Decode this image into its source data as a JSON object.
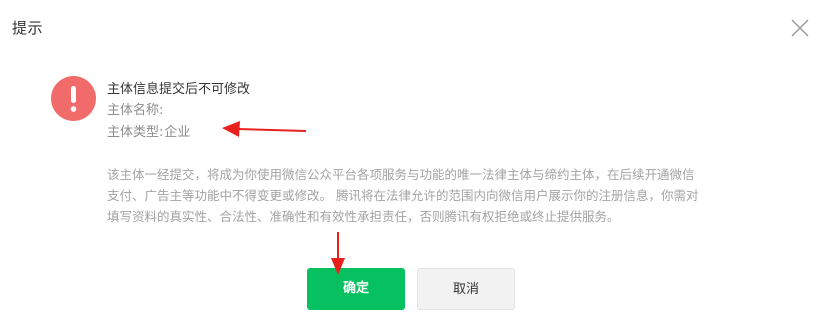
{
  "dialog": {
    "title": "提示",
    "close_icon": "close-icon"
  },
  "info": {
    "icon": "exclamation-icon",
    "icon_color": "#f16b6b",
    "title": "主体信息提交后不可修改",
    "name_label": "主体名称:",
    "name_value": "",
    "type_label": "主体类型:",
    "type_value": "企业"
  },
  "description": {
    "line1": "该主体一经提交，将成为你使用微信公众平台各项服务与功能的唯一法律主体与缔约主体，在后续开通微信",
    "line2": "支付、广告主等功能中不得变更或修改。 腾讯将在法律允许的范围内向微信用户展示你的注册信息，你需对",
    "line3": "填写资料的真实性、合法性、准确性和有效性承担责任，否则腾讯有权拒绝或终止提供服务。"
  },
  "buttons": {
    "confirm_label": "确定",
    "cancel_label": "取消",
    "confirm_color": "#07c160"
  },
  "annotations": {
    "arrow_color": "#e8211d"
  }
}
